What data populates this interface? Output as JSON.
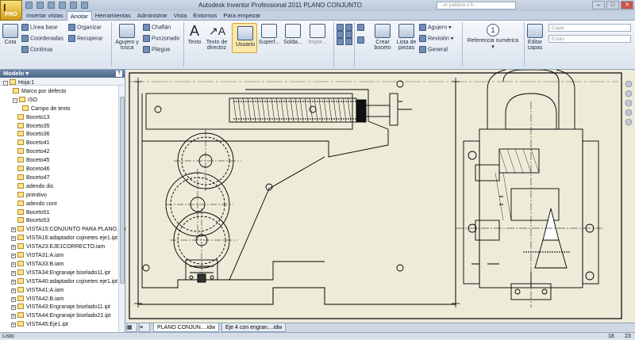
{
  "window": {
    "title": "Autodesk Inventor Professional 2011   PLANO CONJUNTO",
    "search_placeholder": "...er palabra o fr...",
    "app_label": "PRO"
  },
  "tabs": [
    "Insertar vistas",
    "Anotar",
    "Herramientas",
    "Administrar",
    "Vista",
    "Entornos",
    "Para empezar"
  ],
  "active_tab": "Anotar",
  "ribbon": {
    "cota": "Cota",
    "linea_base": "Línea base",
    "coordenadas": "Coordenadas",
    "continua": "Continua",
    "organizar": "Organizar",
    "recuperar": "Recuperar",
    "agujero_rosca": "Agujero y rosca",
    "chaflan": "Chaflán",
    "punzonado": "Punzonado",
    "pliegue": "Pliegue",
    "texto": "Texto",
    "texto_directriz": "Texto de directriz",
    "usuario": "Usuario",
    "superf": "Superf...",
    "solda": "Solda...",
    "impor": "Impor...",
    "crear_boceto": "Crear boceto",
    "lista_piezas": "Lista de piezas",
    "agujero": "Agujero",
    "revision": "Revisión",
    "general": "General",
    "referencia": "Referencia numérica",
    "editar_capas": "Editar capas",
    "capa": "Capa",
    "estilo": "Estilo"
  },
  "browser": {
    "title": "Modelo",
    "nodes": [
      {
        "label": "Hoja:1",
        "exp": "-"
      },
      {
        "label": "Marco por defecto"
      },
      {
        "label": "ISO",
        "exp": "-"
      },
      {
        "label": "Campo de texto"
      },
      {
        "label": "Boceto13"
      },
      {
        "label": "Boceto35"
      },
      {
        "label": "Boceto36"
      },
      {
        "label": "Boceto41"
      },
      {
        "label": "Boceto42"
      },
      {
        "label": "Boceto45"
      },
      {
        "label": "Boceto46"
      },
      {
        "label": "Boceto47"
      },
      {
        "label": "adendo dis"
      },
      {
        "label": "primitivo"
      },
      {
        "label": "adendo cont"
      },
      {
        "label": "Boceto51"
      },
      {
        "label": "Boceto53"
      },
      {
        "label": "VISTA15:CONJUNTO PARA PLANO.iam",
        "exp": "+"
      },
      {
        "label": "VISTA16:adaptador cojinetes eje1.ipt",
        "exp": "+"
      },
      {
        "label": "VISTA23:EJE1CORRECTO.iam",
        "exp": "+"
      },
      {
        "label": "VISTA31:A.iam",
        "exp": "+"
      },
      {
        "label": "VISTA33:B.iam",
        "exp": "+"
      },
      {
        "label": "VISTA34:Engranaje biselado11.ipt",
        "exp": "+"
      },
      {
        "label": "VISTA40:adaptador cojinetes eje1.ipt",
        "exp": "+"
      },
      {
        "label": "VISTA41:A.iam",
        "exp": "+"
      },
      {
        "label": "VISTA42:B.iam",
        "exp": "+"
      },
      {
        "label": "VISTA43:Engranaje biselado11.ipt",
        "exp": "+"
      },
      {
        "label": "VISTA44:Engranaje biselado21.ipt",
        "exp": "+"
      },
      {
        "label": "VISTA45:Eje1.ipt",
        "exp": "+"
      }
    ]
  },
  "doc_tabs": [
    "PLANO CONJUN....idw",
    "Eje 4 con engran....idw"
  ],
  "status": {
    "text": "Listo",
    "n1": "18",
    "n2": "23"
  }
}
